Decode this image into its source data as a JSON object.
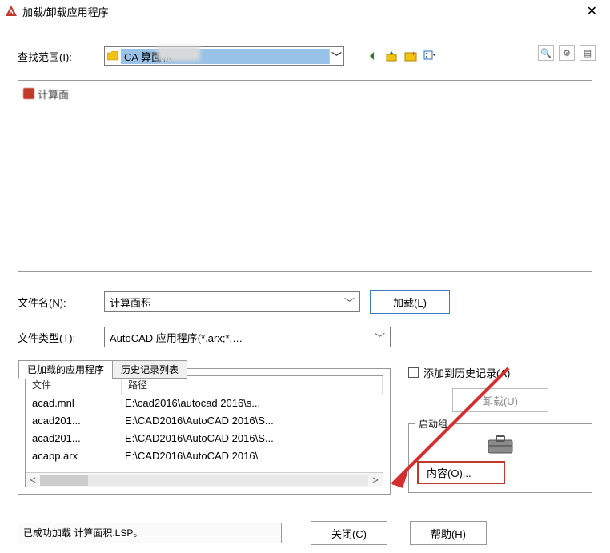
{
  "title": "加载/卸载应用程序",
  "scope_label": "查找范围(I):",
  "scope_value": "CA          算面积",
  "file_item_1": "计算面",
  "filename_label": "文件名(N):",
  "filename_value": "计算面积",
  "filetype_label": "文件类型(T):",
  "filetype_value": "AutoCAD 应用程序(*.arx;*.crx;*.lsp;*.dvb;*.dbx;",
  "load_btn": "加载(L)",
  "tabs": {
    "loaded": "已加载的应用程序",
    "history": "历史记录列表"
  },
  "cols": {
    "file": "文件",
    "path": "路径"
  },
  "rows": [
    {
      "f": "acad.mnl",
      "p": "E:\\cad2016\\autocad 2016\\s..."
    },
    {
      "f": "acad201...",
      "p": "E:\\CAD2016\\AutoCAD 2016\\S..."
    },
    {
      "f": "acad201...",
      "p": "E:\\CAD2016\\AutoCAD 2016\\S..."
    },
    {
      "f": "acapp.arx",
      "p": "E:\\CAD2016\\AutoCAD 2016\\"
    }
  ],
  "add_history": "添加到历史记录(A)",
  "unload_btn": "卸载(U)",
  "startup_group": "启动组",
  "contents_btn": "内容(O)...",
  "status": "已成功加载 计算面积.LSP。",
  "close_btn": "关闭(C)",
  "help_btn": "帮助(H)"
}
